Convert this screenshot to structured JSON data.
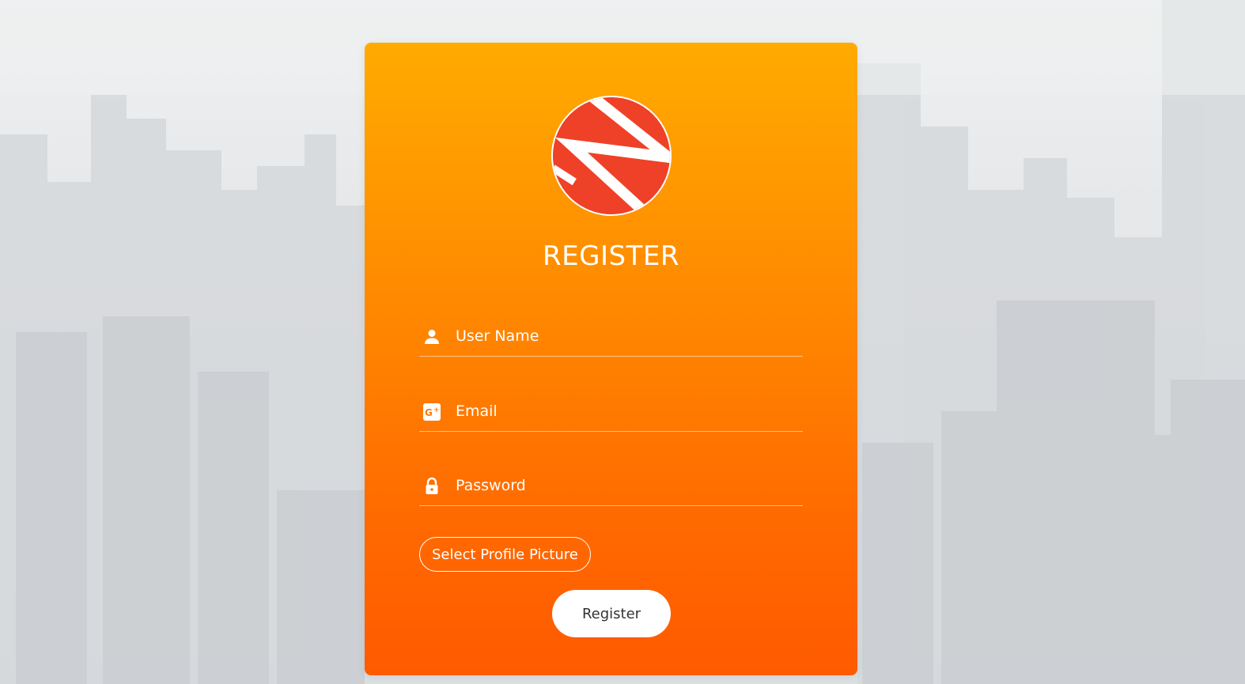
{
  "form": {
    "title": "REGISTER",
    "fields": {
      "username": {
        "placeholder": "User Name",
        "icon": "user-icon"
      },
      "email": {
        "placeholder": "Email",
        "icon": "google-plus-icon"
      },
      "password": {
        "placeholder": "Password",
        "icon": "lock-icon"
      }
    },
    "select_picture_label": "Select Profile Picture",
    "submit_label": "Register"
  },
  "colors": {
    "card_top": "#ffab00",
    "card_bottom": "#ff5a00",
    "logo_red": "#ef4128",
    "text": "#ffffff",
    "button_text": "#333333"
  }
}
